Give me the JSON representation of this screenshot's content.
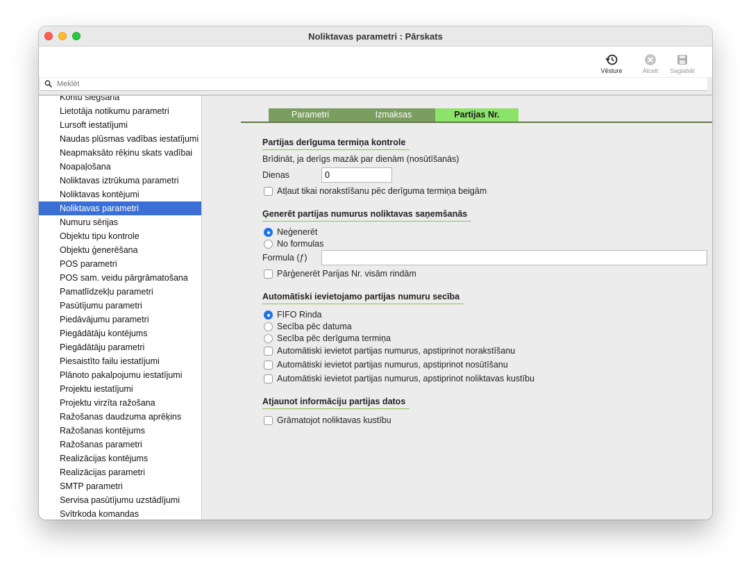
{
  "window": {
    "title": "Noliktavas parametri : Pārskats"
  },
  "toolbar": {
    "history_label": "Vēsture",
    "cancel_label": "Atcelt",
    "save_label": "Saglabāt"
  },
  "search": {
    "placeholder": "Meklēt",
    "value": ""
  },
  "sidebar": {
    "items": [
      "Kontu slēgšana",
      "Lietotāja notikumu parametri",
      "Lursoft iestatījumi",
      "Naudas plūsmas vadības iestatījumi",
      "Neapmaksāto rēķinu skats vadībai",
      "Noapaļošana",
      "Noliktavas iztrūkuma parametri",
      "Noliktavas kontējumi",
      "Noliktavas parametri",
      "Numuru sērijas",
      "Objektu tipu kontrole",
      "Objektu ģenerēšana",
      "POS parametri",
      "POS sam. veidu pārgrāmatošana",
      "Pamatlīdzekļu parametri",
      "Pasūtījumu parametri",
      "Piedāvājumu parametri",
      "Piegādātāju kontējums",
      "Piegādātāju parametri",
      "Piesaistīto failu iestatījumi",
      "Plānoto pakalpojumu iestatījumi",
      "Projektu iestatījumi",
      "Projektu virzīta ražošana",
      "Ražošanas daudzuma aprēķins",
      "Ražošanas kontējums",
      "Ražošanas parametri",
      "Realizācijas kontējums",
      "Realizācijas parametri",
      "SMTP parametri",
      "Servisa pasūtījumu uzstādījumi",
      "Svītrkoda komandas"
    ],
    "selected": "Noliktavas parametri"
  },
  "tabs": [
    "Parametri",
    "Izmaksas",
    "Partijas Nr."
  ],
  "active_tab": "Partijas Nr.",
  "section1": {
    "title": "Partijas derīguma termiņa kontrole",
    "warn_label": "Brīdināt, ja derīgs mazāk par dienām (nosūtīšanās)",
    "days_label": "Dienas",
    "days_value": "0",
    "allow_label": "Atļaut tikai norakstīšanu pēc derīguma termiņa beigām"
  },
  "section2": {
    "title": "Ģenerēt partijas numurus noliktavas saņemšanās",
    "radio_no": "Neģenerēt",
    "radio_formula": "No formulas",
    "formula_label": "Formula (ƒ)",
    "formula_value": "",
    "regen_label": "Pārģenerēt Parijas Nr. visām rindām"
  },
  "section3": {
    "title": "Automātiski ievietojamo partijas numuru secība",
    "radio_fifo": "FIFO Rinda",
    "radio_date": "Secība pēc datuma",
    "radio_expiry": "Secība pēc derīguma termiņa",
    "check_writeoff": "Automātiski ievietot partijas numurus, apstiprinot norakstīšanu",
    "check_send": "Automātiski ievietot partijas numurus, apstiprinot nosūtīšanu",
    "check_move": "Automātiski ievietot partijas numurus, apstiprinot noliktavas kustību"
  },
  "section4": {
    "title": "Atjaunot informāciju partijas datos",
    "check_posting": "Grāmatojot noliktavas kustību"
  },
  "colors": {
    "selection": "#3a6fd8",
    "tab_active": "#8be36a",
    "tab_inactive": "#7b9d60",
    "radio_on": "#1e72e8"
  }
}
